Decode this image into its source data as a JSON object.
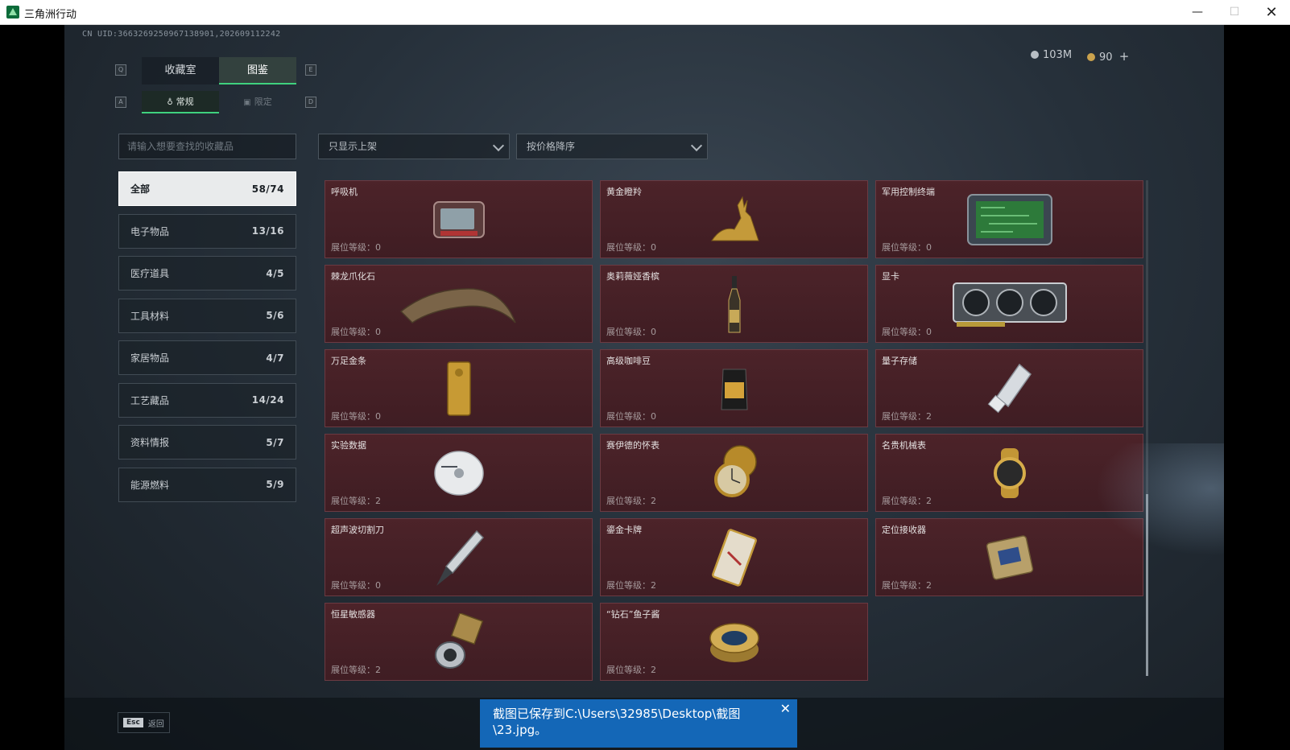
{
  "window": {
    "title": "三角洲行动",
    "min_glyph": "—",
    "max_glyph": "☐",
    "close_glyph": "✕"
  },
  "header": {
    "uid": "CN UID:3663269250967138901,202609112242",
    "currency_silver": "103M",
    "currency_gold": "90",
    "currency_add": "+"
  },
  "key_hints": {
    "tab_left": "Q",
    "tab_right": "E",
    "sub_left": "A",
    "sub_right": "D"
  },
  "tabs": [
    {
      "label": "收藏室"
    },
    {
      "label": "图鉴"
    }
  ],
  "subtabs": [
    {
      "label": "常规"
    },
    {
      "label": "限定"
    }
  ],
  "search": {
    "placeholder": "请输入想要查找的收藏品"
  },
  "filters": {
    "shelf": "只显示上架",
    "sort": "按价格降序"
  },
  "categories": [
    {
      "label": "全部",
      "count": "58/74"
    },
    {
      "label": "电子物品",
      "count": "13/16"
    },
    {
      "label": "医疗道具",
      "count": "4/5"
    },
    {
      "label": "工具材料",
      "count": "5/6"
    },
    {
      "label": "家居物品",
      "count": "4/7"
    },
    {
      "label": "工艺藏品",
      "count": "14/24"
    },
    {
      "label": "资料情报",
      "count": "5/7"
    },
    {
      "label": "能源燃料",
      "count": "5/9"
    }
  ],
  "items": [
    {
      "name": "呼吸机",
      "level": "展位等级：0",
      "icon": "ventilator-icon"
    },
    {
      "name": "黄金瞪羚",
      "level": "展位等级：0",
      "icon": "gold-gazelle-icon"
    },
    {
      "name": "军用控制终端",
      "level": "展位等级：0",
      "icon": "military-terminal-icon"
    },
    {
      "name": "棘龙爪化石",
      "level": "展位等级：0",
      "icon": "claw-fossil-icon"
    },
    {
      "name": "奥莉薇娅香槟",
      "level": "展位等级：0",
      "icon": "champagne-icon"
    },
    {
      "name": "显卡",
      "level": "展位等级：0",
      "icon": "graphics-card-icon"
    },
    {
      "name": "万足金条",
      "level": "展位等级：0",
      "icon": "gold-bar-icon"
    },
    {
      "name": "高级咖啡豆",
      "level": "展位等级：0",
      "icon": "coffee-beans-icon"
    },
    {
      "name": "量子存储",
      "level": "展位等级：2",
      "icon": "quantum-storage-icon"
    },
    {
      "name": "实验数据",
      "level": "展位等级：2",
      "icon": "data-disc-icon"
    },
    {
      "name": "赛伊德的怀表",
      "level": "展位等级：2",
      "icon": "pocket-watch-icon"
    },
    {
      "name": "名贵机械表",
      "level": "展位等级：2",
      "icon": "luxury-watch-icon"
    },
    {
      "name": "超声波切割刀",
      "level": "展位等级：0",
      "icon": "ultrasonic-knife-icon"
    },
    {
      "name": "鎏金卡牌",
      "level": "展位等级：2",
      "icon": "gilded-card-icon"
    },
    {
      "name": "定位接收器",
      "level": "展位等级：2",
      "icon": "gps-receiver-icon"
    },
    {
      "name": "恒星敏感器",
      "level": "展位等级：2",
      "icon": "star-sensor-icon"
    },
    {
      "name": "“钻石”鱼子酱",
      "level": "展位等级：2",
      "icon": "caviar-tin-icon"
    }
  ],
  "footer": {
    "esc_key": "Esc",
    "esc_label": "返回"
  },
  "toast": {
    "message": "截图已保存到C:\\Users\\32985\\Desktop\\截图\\23.jpg。",
    "close": "✕"
  },
  "colors": {
    "accent": "#3fd17e",
    "card_bg": "#4c2329",
    "toast_bg": "#1467b7"
  }
}
